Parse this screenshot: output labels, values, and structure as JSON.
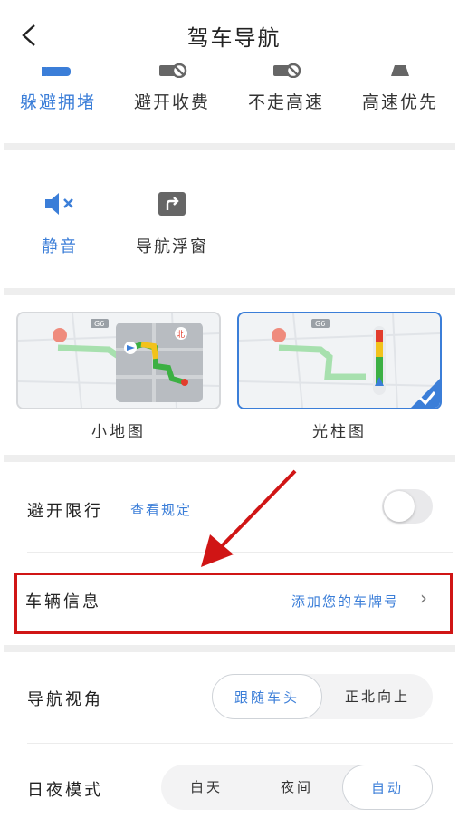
{
  "header": {
    "title": "驾车导航"
  },
  "route_prefs": [
    {
      "label": "躲避拥堵",
      "active": true,
      "icon": "avoid-congestion-icon"
    },
    {
      "label": "避开收费",
      "active": false,
      "icon": "avoid-toll-icon"
    },
    {
      "label": "不走高速",
      "active": false,
      "icon": "no-highway-icon"
    },
    {
      "label": "高速优先",
      "active": false,
      "icon": "highway-first-icon"
    }
  ],
  "tools": [
    {
      "label": "静音",
      "active": true,
      "icon": "mute-icon"
    },
    {
      "label": "导航浮窗",
      "active": false,
      "icon": "floating-window-icon"
    }
  ],
  "map_views": [
    {
      "label": "小地图",
      "selected": false,
      "badge": "北",
      "route_tag": "G6"
    },
    {
      "label": "光柱图",
      "selected": true,
      "route_tag": "G6"
    }
  ],
  "restriction": {
    "label": "避开限行",
    "link": "查看规定",
    "toggle_on": false
  },
  "vehicle": {
    "label": "车辆信息",
    "value": "添加您的车牌号",
    "chevron": "›"
  },
  "nav_view": {
    "label": "导航视角",
    "options": [
      "跟随车头",
      "正北向上"
    ],
    "selected": "跟随车头"
  },
  "day_night": {
    "label": "日夜模式",
    "options": [
      "白天",
      "夜间",
      "自动"
    ],
    "selected": "自动"
  },
  "colors": {
    "accent": "#3b7ed8",
    "highlight": "#d01515",
    "route_green": "#3cb043",
    "route_yellow": "#f2c21b",
    "route_red": "#e23c2c"
  }
}
